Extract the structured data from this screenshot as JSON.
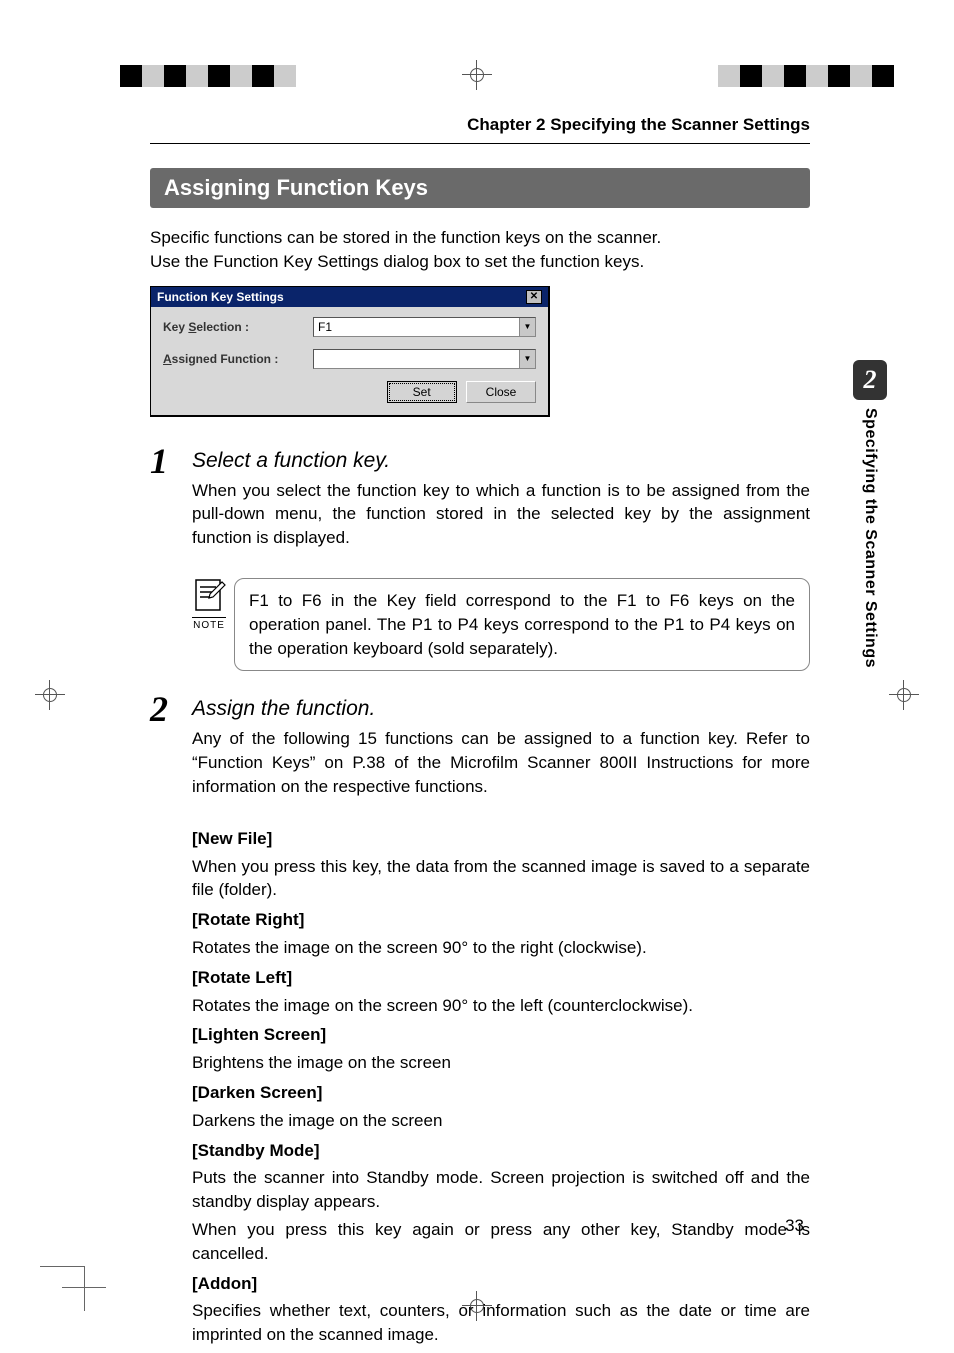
{
  "running_head": "Chapter 2 Specifying the Scanner Settings",
  "section_title": "Assigning Function Keys",
  "intro_line1": "Specific functions can be stored in the function keys on the scanner.",
  "intro_line2": "Use the Function Key Settings dialog box to set the function keys.",
  "dialog": {
    "title": "Function Key Settings",
    "close_glyph": "✕",
    "key_selection_label": "Key Selection :",
    "key_selection_underline": "S",
    "key_selection_value": "F1",
    "assigned_function_label": "Assigned Function :",
    "assigned_function_underline": "A",
    "assigned_function_value": "",
    "btn_set": "Set",
    "btn_close": "Close"
  },
  "steps": {
    "s1": {
      "num": "1",
      "title": "Select a function key.",
      "text": "When you select the function key to which a function is to be assigned from the pull-down menu, the function stored in the selected key by the assignment function is displayed."
    },
    "s2": {
      "num": "2",
      "title": "Assign the function.",
      "text": "Any of the following 15 functions can be assigned to a function key. Refer to “Function Keys” on P.38 of the Microfilm Scanner 800II Instructions for more information on the respective functions."
    }
  },
  "note": {
    "label": "NOTE",
    "text": "F1 to F6 in the Key field correspond to the F1 to F6 keys on the operation panel. The P1 to P4 keys correspond to the P1 to P4 keys on the operation keyboard (sold separately)."
  },
  "functions": {
    "new_file": {
      "head": "[New File]",
      "body": "When you press this key, the data from the scanned image is saved to a separate file (folder)."
    },
    "rotate_right": {
      "head": "[Rotate Right]",
      "body": "Rotates the image on the screen 90° to the right (clockwise)."
    },
    "rotate_left": {
      "head": "[Rotate Left]",
      "body": "Rotates the image on the screen 90° to the left (counterclockwise)."
    },
    "lighten": {
      "head": "[Lighten Screen]",
      "body": "Brightens the image on the screen"
    },
    "darken": {
      "head": "[Darken Screen]",
      "body": "Darkens the image on the screen"
    },
    "standby": {
      "head": "[Standby Mode]",
      "body1": "Puts the scanner into Standby mode. Screen projection is switched off and the standby display appears.",
      "body2": "When you press this key again or press any other key, Standby mode is cancelled."
    },
    "addon": {
      "head": "[Addon]",
      "body": "Specifies whether text, counters, or information such as the date or time are imprinted on the scanned image."
    }
  },
  "side_tab": {
    "num": "2",
    "text": "Specifying the Scanner Settings"
  },
  "page_number": "33"
}
